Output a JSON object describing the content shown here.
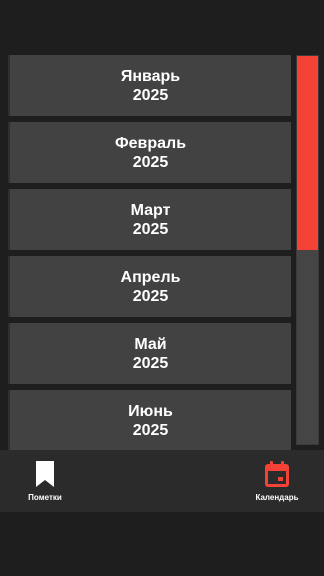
{
  "months": [
    {
      "name": "Январь",
      "year": "2025"
    },
    {
      "name": "Февраль",
      "year": "2025"
    },
    {
      "name": "Март",
      "year": "2025"
    },
    {
      "name": "Апрель",
      "year": "2025"
    },
    {
      "name": "Май",
      "year": "2025"
    },
    {
      "name": "Июнь",
      "year": "2025"
    }
  ],
  "bottom_nav": {
    "notes_label": "Пометки",
    "notes_icon": "bookmark-icon",
    "calendar_label": "Календарь",
    "calendar_icon": "calendar-icon",
    "active_tab": "calendar"
  },
  "scrollbar": {
    "position_fraction": 0.0,
    "visible_fraction": 0.5
  },
  "colors": {
    "background": "#1e1e1e",
    "item_background": "#424242",
    "accent": "#f44336",
    "nav_background": "#2b2b2b",
    "text": "#ffffff"
  }
}
